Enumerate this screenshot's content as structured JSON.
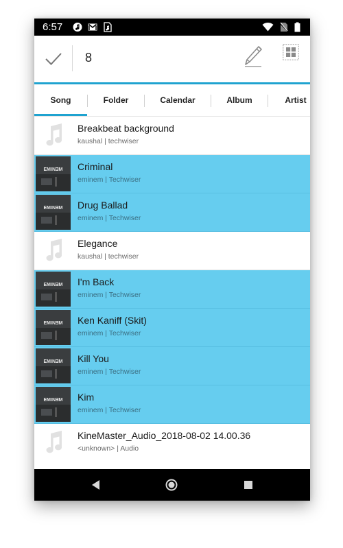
{
  "status_bar": {
    "time": "6:57",
    "left_icons": [
      "music-note-icon",
      "gmail-icon",
      "music-file-icon"
    ],
    "right_icons": [
      "wifi-icon",
      "no-sim-icon",
      "battery-icon"
    ]
  },
  "action_bar": {
    "selected_count": "8",
    "confirm_icon": "check-icon",
    "edit_icon": "pencil-icon",
    "select_all_icon": "grid-icon"
  },
  "tabs": [
    {
      "label": "Song",
      "active": true
    },
    {
      "label": "Folder",
      "active": false
    },
    {
      "label": "Calendar",
      "active": false
    },
    {
      "label": "Album",
      "active": false
    },
    {
      "label": "Artist",
      "active": false
    }
  ],
  "songs": [
    {
      "title": "Breakbeat background",
      "subtitle": "kaushal | techwiser",
      "selected": false,
      "art": "music-note-icon"
    },
    {
      "title": "Criminal",
      "subtitle": "eminem | Techwiser",
      "selected": true,
      "art": "album-art-eminem"
    },
    {
      "title": "Drug Ballad",
      "subtitle": "eminem | Techwiser",
      "selected": true,
      "art": "album-art-eminem"
    },
    {
      "title": "Elegance",
      "subtitle": "kaushal | techwiser",
      "selected": false,
      "art": "music-note-icon"
    },
    {
      "title": "I'm Back",
      "subtitle": "eminem | Techwiser",
      "selected": true,
      "art": "album-art-eminem"
    },
    {
      "title": "Ken Kaniff (Skit)",
      "subtitle": "eminem | Techwiser",
      "selected": true,
      "art": "album-art-eminem"
    },
    {
      "title": "Kill You",
      "subtitle": "eminem | Techwiser",
      "selected": true,
      "art": "album-art-eminem"
    },
    {
      "title": "Kim",
      "subtitle": "eminem | Techwiser",
      "selected": true,
      "art": "album-art-eminem"
    },
    {
      "title": "KineMaster_Audio_2018-08-02 14.00.36",
      "subtitle": "<unknown> | Audio",
      "selected": false,
      "art": "music-note-icon"
    }
  ],
  "album_art_text": "EMINƎM",
  "colors": {
    "accent": "#1fa3d0",
    "selected_row": "#66cdef",
    "status_bar": "#000000",
    "nav_bar": "#000000"
  },
  "nav_bar": {
    "buttons": [
      "back-icon",
      "home-icon",
      "recents-icon"
    ]
  }
}
